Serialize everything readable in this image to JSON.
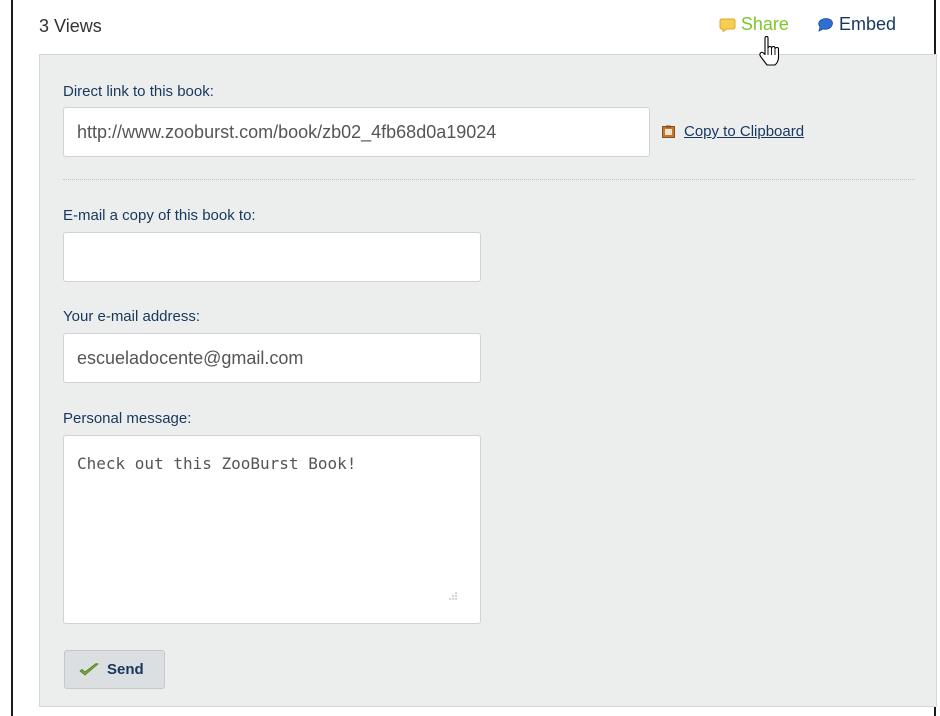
{
  "header": {
    "views_text": "3 Views",
    "share_label": "Share",
    "embed_label": "Embed"
  },
  "share_panel": {
    "direct_link_label": "Direct link to this book:",
    "direct_link_value": "http://www.zooburst.com/book/zb02_4fb68d0a19024",
    "copy_label": "Copy to Clipboard",
    "email_to_label": "E-mail a copy of this book to:",
    "email_to_value": "",
    "your_email_label": "Your e-mail address:",
    "your_email_value": "escueladocente@gmail.com",
    "message_label": "Personal message:",
    "message_value": "Check out this ZooBurst Book!",
    "send_label": "Send"
  },
  "icons": {
    "share": "share-bubble-icon",
    "embed": "embed-bubble-icon",
    "copy": "clipboard-icon",
    "send": "checkmark-icon",
    "cursor": "hand-pointer-icon"
  },
  "colors": {
    "share_active": "#7dc62b",
    "link_text": "#17375e",
    "panel_bg": "#eceeee"
  }
}
